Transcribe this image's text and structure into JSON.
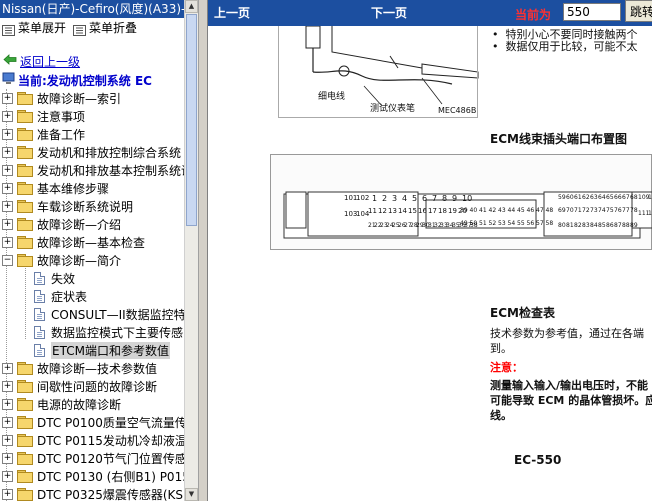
{
  "window": {
    "title": "Nissan(日产)-Cefiro(风度)(A33)-"
  },
  "menu": {
    "expand_label": "菜单展开",
    "collapse_label": "菜单折叠"
  },
  "nav_back": {
    "label": "返回上一级"
  },
  "current": {
    "label": "当前:发动机控制系统  EC"
  },
  "tree": {
    "items": [
      {
        "label": "故障诊断—索引"
      },
      {
        "label": "注意事项"
      },
      {
        "label": "准备工作"
      },
      {
        "label": "发动机和排放控制综合系统"
      },
      {
        "label": "发动机和排放基本控制系统说"
      },
      {
        "label": "基本维修步骤"
      },
      {
        "label": "车载诊断系统说明"
      },
      {
        "label": "故障诊断—介绍"
      },
      {
        "label": "故障诊断—基本检查"
      },
      {
        "label": "故障诊断—简介"
      }
    ],
    "children": [
      {
        "label": "失效"
      },
      {
        "label": "症状表"
      },
      {
        "label": "CONSULT—II数据监控特"
      },
      {
        "label": "数据监控模式下主要传感"
      },
      {
        "label": "ETCM端口和参考数值"
      }
    ],
    "items_after": [
      {
        "label": "故障诊断—技术参数值"
      },
      {
        "label": "间歇性问题的故障诊断"
      },
      {
        "label": "电源的故障诊断"
      },
      {
        "label": "DTC P0100质量空气流量传"
      },
      {
        "label": "DTC P0115发动机冷却液温"
      },
      {
        "label": "DTC P0120节气门位置传感"
      },
      {
        "label": "DTC P0130 (右侧B1) P015"
      },
      {
        "label": "DTC P0325爆震传感器(KS"
      }
    ]
  },
  "toolbar": {
    "prev_label": "上一页",
    "next_label": "下一页",
    "current_label": "当前为",
    "page_value": "550",
    "jump_label": "跳转"
  },
  "document": {
    "bullet1": "特别小心不要同时接触两个",
    "bullet2": "数据仅用于比较，可能不太",
    "probe_label": "细电线",
    "tester_label": "测试仪表笔",
    "figure1_code": "MEC486B",
    "heading1": "ECM线束插头端口布置图",
    "heading2": "ECM检查表",
    "para1_line1": "技术参数为参考值，通过在各端",
    "para1_line2": "到。",
    "note_label": "注意：",
    "note_line1": "测量输入输入/输出电压时，不能",
    "note_line2": "可能导致 ECM 的晶体管损坏。应",
    "note_line3": "线。",
    "page_number": "EC-550",
    "conn_left_top": [
      "101",
      "102"
    ],
    "conn_left_bottom": [
      "103",
      "104"
    ],
    "conn_b1_top": [
      "1",
      "2",
      "3",
      "4",
      "5",
      "6",
      "7",
      "8",
      "9",
      "10"
    ],
    "conn_b1_mid": [
      "11",
      "12",
      "13",
      "14",
      "15",
      "16",
      "17",
      "18",
      "19",
      "20"
    ],
    "conn_b1_bot": [
      "21",
      "22",
      "23",
      "24",
      "25",
      "26",
      "27",
      "28",
      "29",
      "30",
      "31",
      "32",
      "33",
      "34",
      "35",
      "36",
      "37",
      "38"
    ],
    "conn_b2_top": [
      "39",
      "40",
      "41",
      "42",
      "43",
      "44",
      "45",
      "46",
      "47",
      "48"
    ],
    "conn_b2_mid": [
      "49",
      "50",
      "51",
      "52",
      "53",
      "54",
      "55",
      "56",
      "57",
      "58"
    ],
    "conn_b3_top": [
      "59",
      "60",
      "61",
      "62",
      "63",
      "64",
      "65",
      "66",
      "67",
      "68"
    ],
    "conn_b3_mid": [
      "69",
      "70",
      "71",
      "72",
      "73",
      "74",
      "75",
      "76",
      "77",
      "78"
    ],
    "conn_b3_bot": [
      "80",
      "81",
      "82",
      "83",
      "84",
      "85",
      "86",
      "87",
      "88",
      "89"
    ],
    "conn_right_top": [
      "109",
      "110"
    ],
    "conn_right_bottom": [
      "111",
      "112"
    ]
  },
  "colors": {
    "titlebar": "#1c4fa0",
    "link": "#0000cc",
    "current_label": "#ff3030",
    "note": "#ff0000"
  }
}
